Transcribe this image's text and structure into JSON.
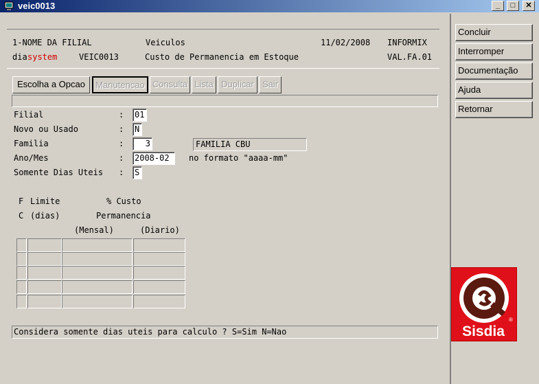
{
  "window": {
    "title": "veic0013"
  },
  "header": {
    "line1_left": "1-NOME DA FILIAL",
    "line1_mid": "Veiculos",
    "line1_date": "11/02/2008",
    "line1_right": "INFORMIX",
    "line2_dia": "dia",
    "line2_system": "system",
    "line2_code": "VEIC0013",
    "line2_desc": "Custo de Permanencia em Estoque",
    "line2_ver": "VAL.FA.01"
  },
  "sidebar": {
    "concluir": "Concluir",
    "interromper": "Interromper",
    "documentacao": "Documentação",
    "ajuda": "Ajuda",
    "retornar": "Retornar"
  },
  "toolbar": {
    "escolha": "Escolha a Opcao",
    "manutencao": "Manutencao",
    "consulta": "Consulta",
    "lista": "Lista",
    "duplicar": "Duplicar",
    "sair": "Sair"
  },
  "form": {
    "filial_label": "Filial",
    "filial_value": "01",
    "novo_label": "Novo ou Usado",
    "novo_value": "N",
    "familia_label": "Familia",
    "familia_value": "3",
    "familia_desc": "FAMILIA CBU",
    "anomes_label": "Ano/Mes",
    "anomes_value": "2008-02",
    "anomes_hint": "no formato \"aaaa-mm\"",
    "dias_label": "Somente Dias Uteis",
    "dias_value": "S",
    "colon": ":"
  },
  "table": {
    "h_f": "F",
    "h_limite": "Limite",
    "h_custo": "% Custo",
    "h_c": "C",
    "h_dias": "(dias)",
    "h_perm": "Permanencia",
    "h_mensal": "(Mensal)",
    "h_diario": "(Diario)"
  },
  "status": {
    "message": "Considera somente dias uteis para calculo ? S=Sim  N=Nao"
  },
  "logo": {
    "text": "Sisdia",
    "reg": "®"
  },
  "colors": {
    "system_red": "#d00000",
    "logo_red": "#e0101a"
  }
}
